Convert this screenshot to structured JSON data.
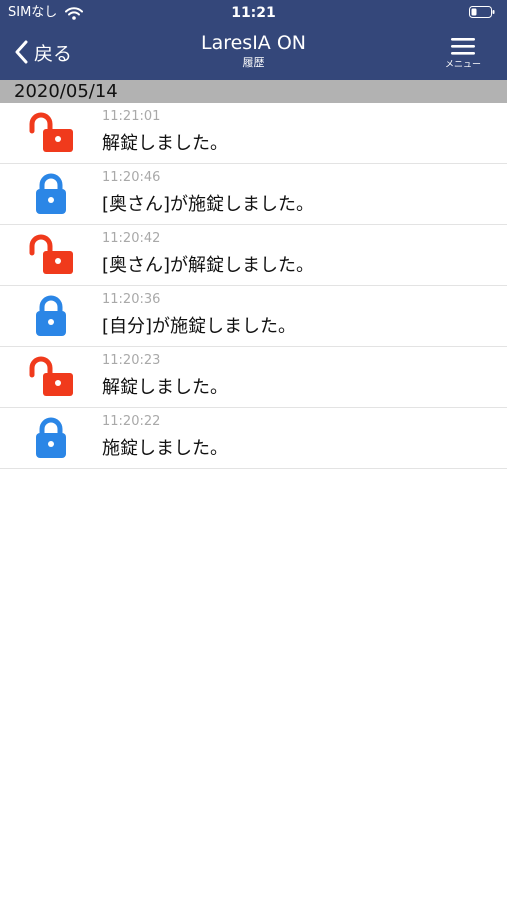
{
  "status_bar": {
    "carrier": "SIMなし",
    "time": "11:21"
  },
  "nav": {
    "back_label": "戻る",
    "title": "LaresIA ON",
    "subtitle": "履歴",
    "menu_label": "メニュー"
  },
  "colors": {
    "nav_background": "#34477a",
    "date_header_background": "#b2b2b2",
    "unlocked_icon": "#f03a1c",
    "locked_icon": "#2b86e6"
  },
  "date_header": "2020/05/14",
  "history": [
    {
      "time": "11:21:01",
      "message": "解錠しました。",
      "icon": "unlocked-padlock-icon"
    },
    {
      "time": "11:20:46",
      "message": "[奥さん]が施錠しました。",
      "icon": "locked-padlock-icon"
    },
    {
      "time": "11:20:42",
      "message": "[奥さん]が解錠しました。",
      "icon": "unlocked-padlock-icon"
    },
    {
      "time": "11:20:36",
      "message": "[自分]が施錠しました。",
      "icon": "locked-padlock-icon"
    },
    {
      "time": "11:20:23",
      "message": "解錠しました。",
      "icon": "unlocked-padlock-icon"
    },
    {
      "time": "11:20:22",
      "message": "施錠しました。",
      "icon": "locked-padlock-icon"
    }
  ]
}
